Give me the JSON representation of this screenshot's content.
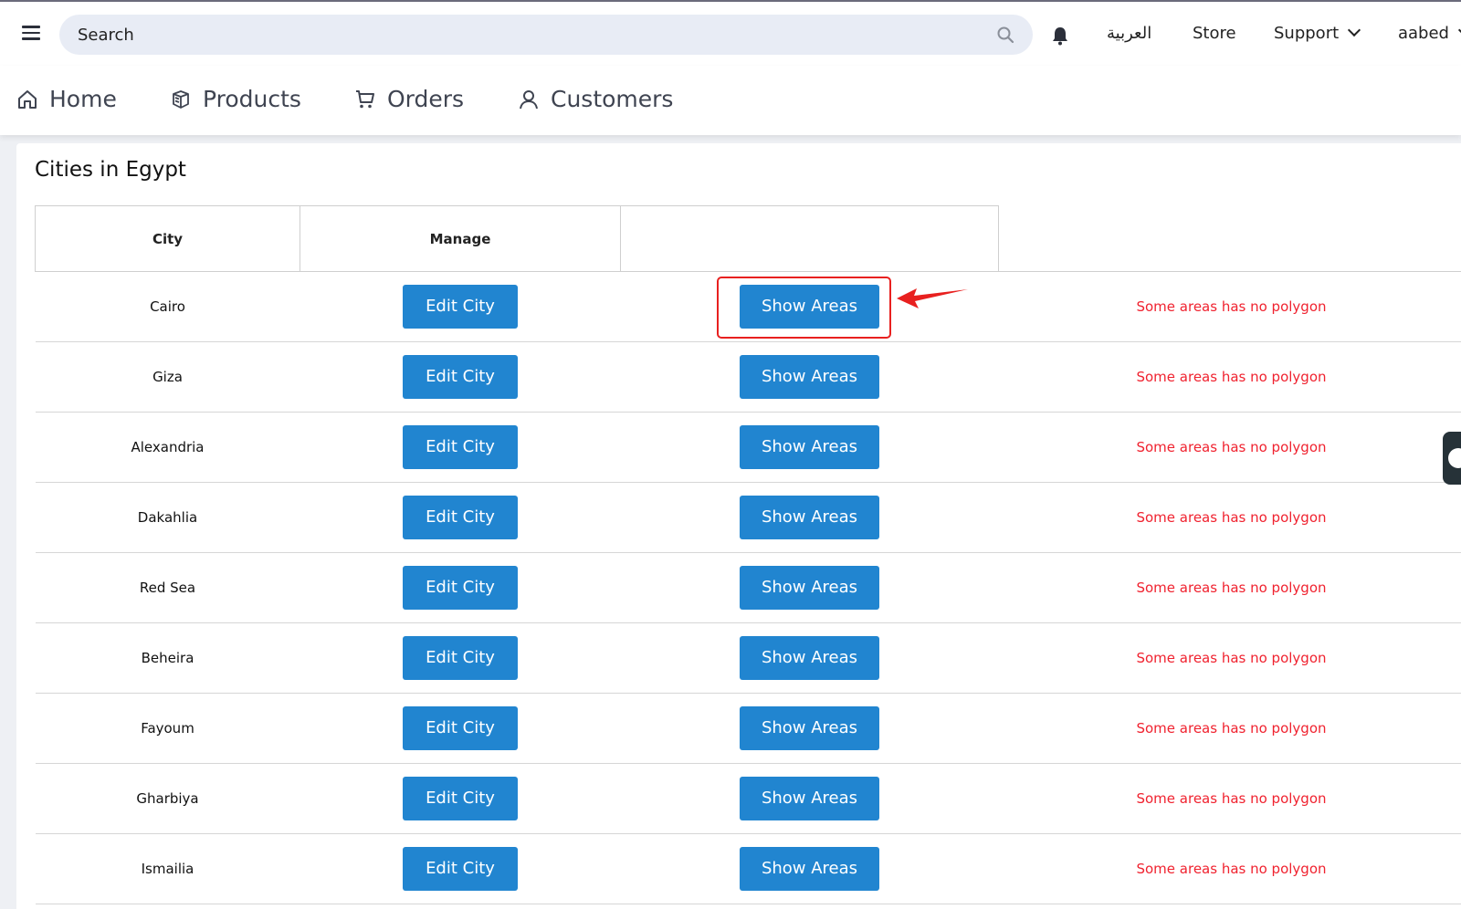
{
  "topbar": {
    "search_placeholder": "Search",
    "arabic_label": "العربية",
    "store_label": "Store",
    "support_label": "Support",
    "user_label": "aabed"
  },
  "nav": {
    "items": [
      {
        "label": "Home",
        "icon": "home-icon"
      },
      {
        "label": "Products",
        "icon": "box-icon"
      },
      {
        "label": "Orders",
        "icon": "cart-icon"
      },
      {
        "label": "Customers",
        "icon": "user-icon"
      }
    ]
  },
  "page": {
    "title": "Cities in Egypt"
  },
  "table": {
    "columns": [
      "City",
      "Manage",
      "",
      ""
    ],
    "edit_label": "Edit City",
    "show_label": "Show Areas",
    "rows": [
      {
        "city": "Cairo",
        "status": "Some areas has no polygon"
      },
      {
        "city": "Giza",
        "status": "Some areas has no polygon"
      },
      {
        "city": "Alexandria",
        "status": "Some areas has no polygon"
      },
      {
        "city": "Dakahlia",
        "status": "Some areas has no polygon"
      },
      {
        "city": "Red Sea",
        "status": "Some areas has no polygon"
      },
      {
        "city": "Beheira",
        "status": "Some areas has no polygon"
      },
      {
        "city": "Fayoum",
        "status": "Some areas has no polygon"
      },
      {
        "city": "Gharbiya",
        "status": "Some areas has no polygon"
      },
      {
        "city": "Ismailia",
        "status": "Some areas has no polygon"
      }
    ]
  },
  "colors": {
    "primary_button": "#2185d0",
    "warning_text": "#f0222f",
    "annotation": "#e8201f"
  }
}
